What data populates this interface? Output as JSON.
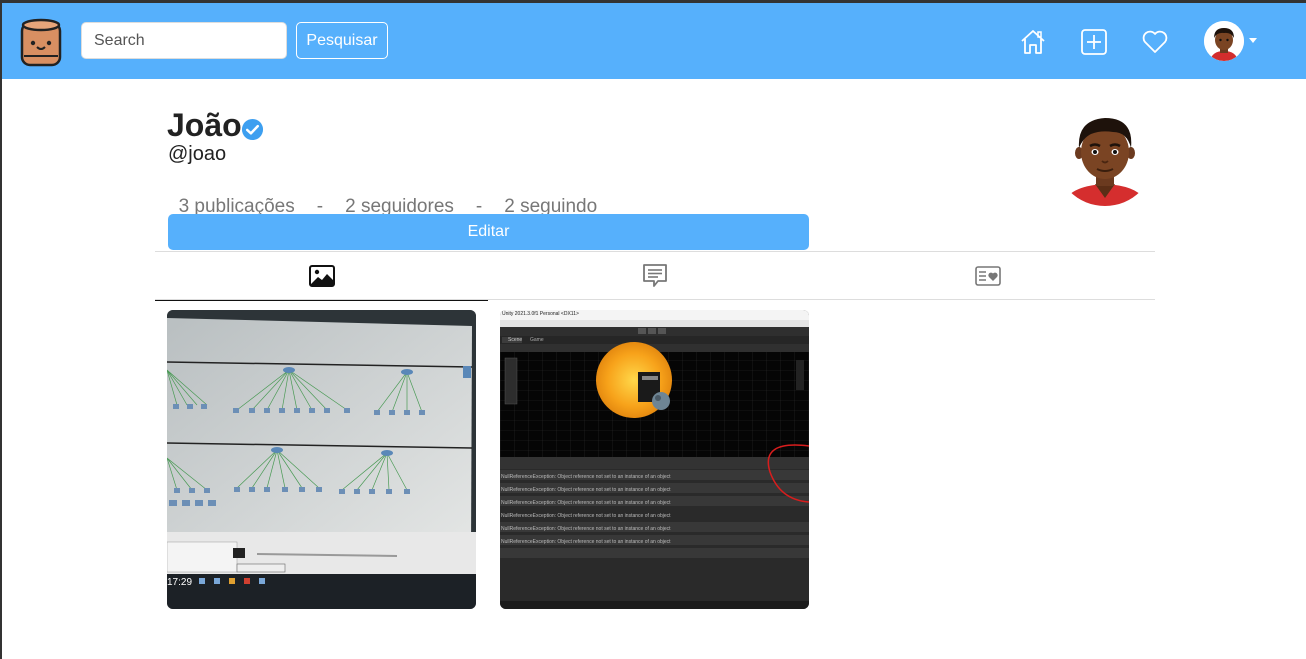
{
  "colors": {
    "accent": "#56b0fc",
    "text": "#222222",
    "muted": "#777777"
  },
  "navbar": {
    "logo_icon": "barrel-face-logo",
    "search": {
      "placeholder": "Search",
      "value": ""
    },
    "search_button": "Pesquisar",
    "icons": [
      "home-icon",
      "add-post-icon",
      "heart-icon",
      "avatar",
      "caret-down-icon"
    ]
  },
  "profile": {
    "name": "João",
    "verified_icon": "verified-badge-icon",
    "handle": "@joao",
    "stats": {
      "posts": "3 publicações",
      "sep1": "-",
      "followers": "2 seguidores",
      "sep2": "-",
      "following": "2 seguindo"
    },
    "edit_button": "Editar"
  },
  "tabs": [
    {
      "icon": "image-icon",
      "active": true
    },
    {
      "icon": "comment-icon",
      "active": false
    },
    {
      "icon": "liked-list-icon",
      "active": false
    }
  ],
  "posts": [
    {
      "type": "photo-of-network-diagram-screen",
      "overlay_time": "17:29"
    },
    {
      "type": "screenshot-3d-editor-sun-scene",
      "window_title": "Unity 2021.3.0f1 Personal <DX11>",
      "scene_tab": "Scene",
      "game_tab": "Game",
      "console_lines": [
        "NullReferenceException: Object reference not set to an instance of an object",
        "NullReferenceException: Object reference not set to an instance of an object",
        "NullReferenceException: Object reference not set to an instance of an object",
        "NullReferenceException: Object reference not set to an instance of an object",
        "NullReferenceException: Object reference not set to an instance of an object",
        "NullReferenceException: Object reference not set to an instance of an object"
      ]
    }
  ]
}
